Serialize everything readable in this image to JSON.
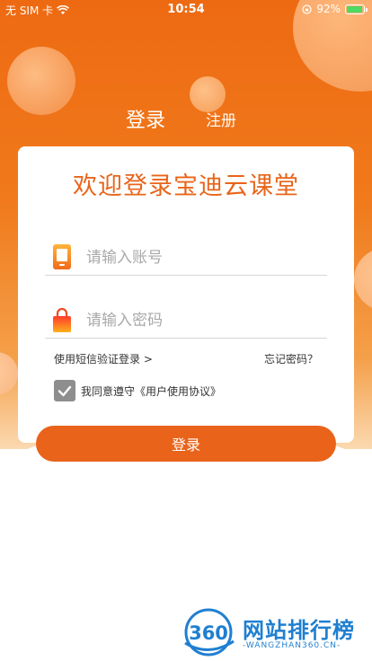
{
  "status_bar": {
    "carrier": "无 SIM 卡",
    "time": "10:54",
    "battery": "92%",
    "battery_level": 0.92
  },
  "tabs": {
    "login": "登录",
    "register": "注册"
  },
  "card": {
    "title": "欢迎登录宝迪云课堂",
    "account_placeholder": "请输入账号",
    "password_placeholder": "请输入密码",
    "sms_login": "使用短信验证登录 >",
    "forgot_password": "忘记密码？",
    "agree_text": "我同意遵守《用户使用协议》",
    "agree_checked": true
  },
  "login_button": "登录",
  "watermark": {
    "logo": "360",
    "title": "网站排行榜",
    "subtitle": "-WANGZHAN360.CN-"
  },
  "colors": {
    "accent": "#e9631a",
    "title": "#e8651a",
    "checkbox": "#8e8e8e",
    "watermark": "#1f7fd1"
  }
}
